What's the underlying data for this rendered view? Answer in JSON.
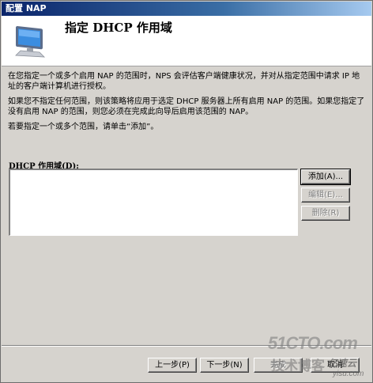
{
  "window": {
    "title": "配置 NAP"
  },
  "header": {
    "title": "指定 DHCP 作用域",
    "icon": "monitor-icon"
  },
  "content": {
    "paragraph1": "在您指定一个或多个启用 NAP 的范围时，NPS 会评估客户端健康状况，并对从指定范围中请求 IP 地址的客户端计算机进行授权。",
    "paragraph2": "如果您不指定任何范围，则该策略将应用于选定 DHCP 服务器上所有启用 NAP 的范围。如果您指定了没有启用 NAP 的范围，则您必须在完成此向导后启用该范围的 NAP。",
    "paragraph3": "若要指定一个或多个范围，请单击“添加”。"
  },
  "scope_list": {
    "label": "DHCP 作用域(D):",
    "items": []
  },
  "side_buttons": {
    "add": "添加(A)...",
    "edit": "编辑(E)...",
    "delete": "删除(R)"
  },
  "nav_buttons": {
    "prev": "上一步(P)",
    "next": "下一步(N)",
    "finish": "完成",
    "cancel": "取消"
  },
  "watermark": {
    "line1": "51CTO.com",
    "line2": "技术博客",
    "line3": "亿速云",
    "line4": "yisu.com"
  }
}
